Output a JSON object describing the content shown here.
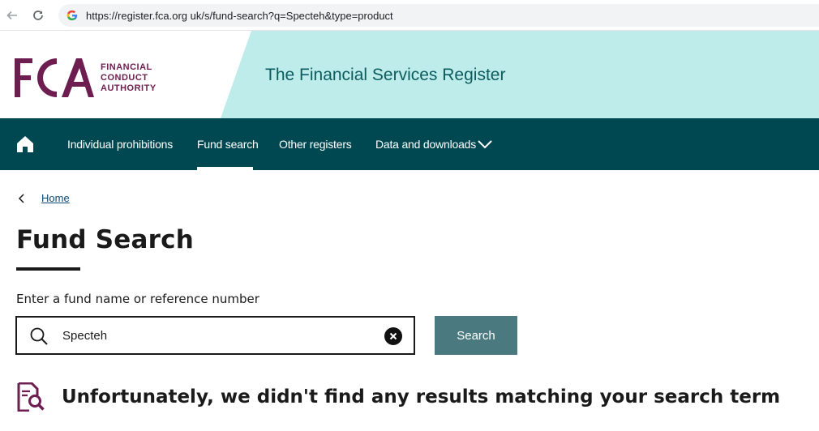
{
  "browser": {
    "url": "https://register.fca.org uk/s/fund-search?q=Specteh&type=product"
  },
  "header": {
    "logo_lines": [
      "FINANCIAL",
      "CONDUCT",
      "AUTHORITY"
    ],
    "register_title": "The Financial Services Register",
    "colors": {
      "teal_band": "#bdecea",
      "brand": "#6d1d4f",
      "title": "#0c5c5f"
    }
  },
  "nav": {
    "items": [
      {
        "label": "Individual prohibitions"
      },
      {
        "label": "Fund search"
      },
      {
        "label": "Other registers"
      },
      {
        "label": "Data and downloads"
      }
    ],
    "active": "Fund search",
    "color": "#004851"
  },
  "breadcrumb": {
    "home": "Home"
  },
  "page": {
    "title": "Fund Search"
  },
  "search": {
    "label": "Enter a fund name or reference number",
    "value": "Specteh",
    "button_label": "Search",
    "button_color": "#4a7a7f"
  },
  "results": {
    "message": "Unfortunately, we didn't find any results matching your search term"
  }
}
